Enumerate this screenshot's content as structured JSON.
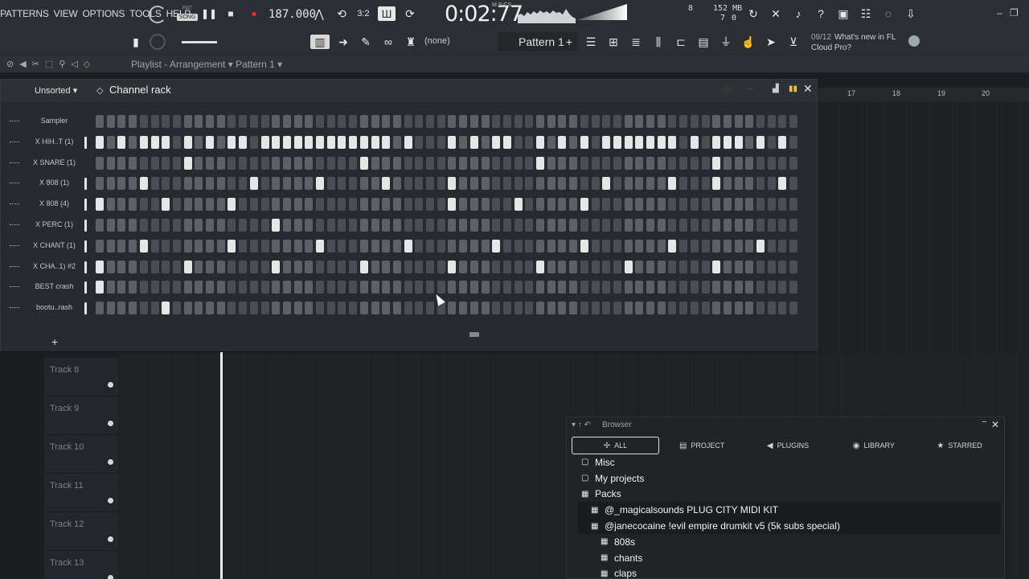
{
  "menu": [
    "PATTERNS",
    "VIEW",
    "OPTIONS",
    "TOOLS",
    "HELP"
  ],
  "transport": {
    "mode_pat": "PAT",
    "mode_song": "SONG",
    "tempo": "187.000",
    "time": "0:02:77",
    "time_unit": "M:S:CS",
    "cpu_a": "8",
    "cpu_b": "7",
    "memory": "152 MB",
    "memory_sub": "0"
  },
  "toolbar2": {
    "snap": "(none)",
    "pattern": "Pattern 1",
    "news_date": "09/12",
    "news_text_1": "What's new in FL",
    "news_text_2": "Cloud Pro?"
  },
  "playlist": {
    "title": "Playlist - Arrangement",
    "pattern": "Pattern 1",
    "bars": [
      "17",
      "18",
      "19",
      "20"
    ],
    "tracks": [
      "Track 8",
      "Track 9",
      "Track 10",
      "Track 11",
      "Track 12",
      "Track 13"
    ]
  },
  "rack": {
    "sort": "Unsorted",
    "title": "Channel rack",
    "channels": [
      {
        "name": "Sampler",
        "selected": false,
        "steps": []
      },
      {
        "name": "X HIH..T (1)",
        "selected": true,
        "steps": [
          0,
          2,
          4,
          5,
          6,
          8,
          10,
          12,
          13,
          15,
          16,
          17,
          18,
          19,
          20,
          21,
          22,
          23,
          24,
          25,
          26,
          28,
          32,
          34,
          36,
          37,
          40,
          42,
          44,
          46,
          47,
          48,
          49,
          50,
          51,
          52,
          54,
          56,
          57,
          58,
          60,
          62,
          64,
          65
        ]
      },
      {
        "name": "X SNARE (1)",
        "selected": false,
        "steps": [
          8,
          24,
          40,
          56
        ]
      },
      {
        "name": "X 808 (1)",
        "selected": true,
        "steps": [
          4,
          14,
          20,
          26,
          32,
          46,
          52,
          56,
          62
        ]
      },
      {
        "name": "X 808 (4)",
        "selected": true,
        "steps": [
          0,
          6,
          12,
          32,
          38,
          44
        ]
      },
      {
        "name": "X PERC (1)",
        "selected": true,
        "steps": [
          16
        ]
      },
      {
        "name": "X CHANT (1)",
        "selected": true,
        "steps": [
          4,
          12,
          20,
          28,
          36,
          44,
          52,
          60
        ]
      },
      {
        "name": "X CHA..1) #2",
        "selected": true,
        "steps": [
          0,
          8,
          16,
          24,
          32,
          40,
          48,
          56
        ]
      },
      {
        "name": "BEST crash",
        "selected": true,
        "steps": [
          0
        ]
      },
      {
        "name": "bootu..rash",
        "selected": true,
        "steps": [
          6
        ]
      }
    ]
  },
  "browser": {
    "title": "Browser",
    "tabs": [
      {
        "label": "ALL",
        "icon": "all-icon"
      },
      {
        "label": "PROJECT",
        "icon": "document-icon"
      },
      {
        "label": "PLUGINS",
        "icon": "plugin-icon"
      },
      {
        "label": "LIBRARY",
        "icon": "library-icon"
      },
      {
        "label": "STARRED",
        "icon": "star-icon"
      }
    ],
    "tree": [
      {
        "label": "Misc",
        "level": 0,
        "icon": "folder-icon"
      },
      {
        "label": "My projects",
        "level": 0,
        "icon": "folder-icon"
      },
      {
        "label": "Packs",
        "level": 0,
        "icon": "pack-folder-icon"
      },
      {
        "label": "@_magicalsounds PLUG CITY MIDI KIT",
        "level": 1,
        "icon": "pack-folder-icon"
      },
      {
        "label": "@janecocaine !evil empire drumkit v5 (5k subs special)",
        "level": 1,
        "icon": "pack-folder-icon"
      },
      {
        "label": "808s",
        "level": 2,
        "icon": "pack-folder-icon"
      },
      {
        "label": "chants",
        "level": 2,
        "icon": "pack-folder-icon"
      },
      {
        "label": "claps",
        "level": 2,
        "icon": "pack-folder-icon"
      }
    ]
  },
  "colors": {
    "step_on": "#e6e6e6",
    "step_off": "#5d6166",
    "panel": "#272a2e"
  }
}
